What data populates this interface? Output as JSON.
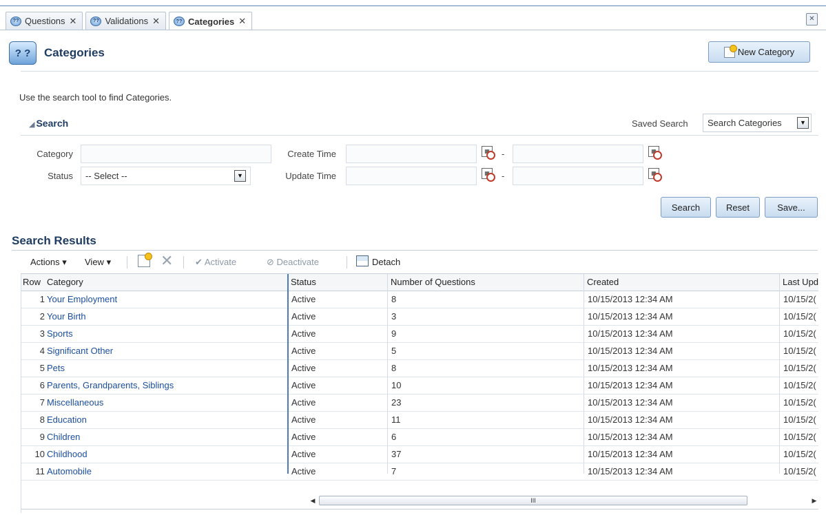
{
  "tabs": [
    {
      "label": "Questions",
      "active": false
    },
    {
      "label": "Validations",
      "active": false
    },
    {
      "label": "Categories",
      "active": true
    }
  ],
  "header": {
    "title": "Categories",
    "new_button": "New Category"
  },
  "instructions": "Use the search tool to find Categories.",
  "search": {
    "title": "Search",
    "saved_search_label": "Saved Search",
    "saved_search_value": "Search Categories",
    "fields": {
      "category_label": "Category",
      "status_label": "Status",
      "status_value": "-- Select --",
      "create_time_label": "Create Time",
      "update_time_label": "Update Time",
      "range_separator": "-"
    },
    "buttons": {
      "search": "Search",
      "reset": "Reset",
      "save": "Save..."
    }
  },
  "results": {
    "title": "Search Results",
    "toolbar": {
      "actions": "Actions",
      "view": "View",
      "activate": "Activate",
      "deactivate": "Deactivate",
      "detach": "Detach"
    },
    "columns": [
      "Row",
      "Category",
      "Status",
      "Number of Questions",
      "Created",
      "Last Upd"
    ],
    "rows": [
      {
        "row": "1",
        "category": "Your Employment",
        "status": "Active",
        "count": "8",
        "created": "10/15/2013 12:34 AM",
        "updated": "10/15/2("
      },
      {
        "row": "2",
        "category": "Your Birth",
        "status": "Active",
        "count": "3",
        "created": "10/15/2013 12:34 AM",
        "updated": "10/15/2("
      },
      {
        "row": "3",
        "category": "Sports",
        "status": "Active",
        "count": "9",
        "created": "10/15/2013 12:34 AM",
        "updated": "10/15/2("
      },
      {
        "row": "4",
        "category": "Significant Other",
        "status": "Active",
        "count": "5",
        "created": "10/15/2013 12:34 AM",
        "updated": "10/15/2("
      },
      {
        "row": "5",
        "category": "Pets",
        "status": "Active",
        "count": "8",
        "created": "10/15/2013 12:34 AM",
        "updated": "10/15/2("
      },
      {
        "row": "6",
        "category": "Parents, Grandparents, Siblings",
        "status": "Active",
        "count": "10",
        "created": "10/15/2013 12:34 AM",
        "updated": "10/15/2("
      },
      {
        "row": "7",
        "category": "Miscellaneous",
        "status": "Active",
        "count": "23",
        "created": "10/15/2013 12:34 AM",
        "updated": "10/15/2("
      },
      {
        "row": "8",
        "category": "Education",
        "status": "Active",
        "count": "11",
        "created": "10/15/2013 12:34 AM",
        "updated": "10/15/2("
      },
      {
        "row": "9",
        "category": "Children",
        "status": "Active",
        "count": "6",
        "created": "10/15/2013 12:34 AM",
        "updated": "10/15/2("
      },
      {
        "row": "10",
        "category": "Childhood",
        "status": "Active",
        "count": "37",
        "created": "10/15/2013 12:34 AM",
        "updated": "10/15/2("
      },
      {
        "row": "11",
        "category": "Automobile",
        "status": "Active",
        "count": "7",
        "created": "10/15/2013 12:34 AM",
        "updated": "10/15/2("
      }
    ],
    "scrollbar_grip": "III"
  },
  "icons": {
    "tab_icon": "help-bubble-icon",
    "page_icon": "question-cube-icon",
    "new_icon": "new-item-icon",
    "calendar_icon": "calendar-clock-icon",
    "detach_icon": "detach-icon",
    "delete_icon": "delete-icon"
  },
  "colors": {
    "link": "#1b4fa0",
    "heading": "#1f3c63",
    "button_border": "#7b9cc2"
  }
}
